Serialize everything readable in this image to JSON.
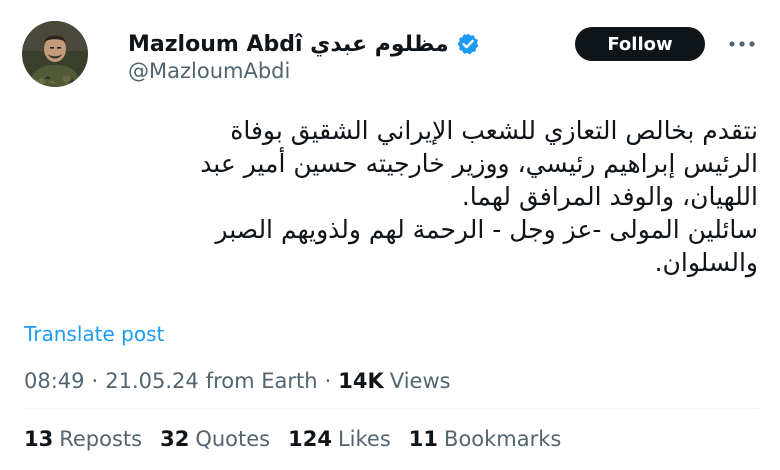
{
  "author": {
    "display_name": "Mazloum Abdî مظلوم عبدي",
    "handle": "@MazloumAbdi",
    "verified": true,
    "avatar_icon": "profile-photo-icon",
    "verified_icon": "verified-badge-icon"
  },
  "actions": {
    "follow_label": "Follow",
    "more_icon": "more-options-icon"
  },
  "post": {
    "text_lines": [
      "نتقدم بخالص التعازي للشعب الإيراني الشقيق بوفاة",
      "الرئيس إبراهيم رئيسي، ووزير خارجيته حسين أمير عبد",
      "اللهيان، والوفد المرافق لهما.",
      "سائلين المولى -عز وجل - الرحمة لهم ولذويهم الصبر",
      "والسلوان."
    ],
    "translate_label": "Translate post"
  },
  "meta": {
    "time": "08:49",
    "separator": "·",
    "date": "21.05.24",
    "source": "from Earth",
    "views_count": "14K",
    "views_label": "Views"
  },
  "stats": [
    {
      "count": "13",
      "label": "Reposts"
    },
    {
      "count": "32",
      "label": "Quotes"
    },
    {
      "count": "124",
      "label": "Likes"
    },
    {
      "count": "11",
      "label": "Bookmarks"
    }
  ],
  "colors": {
    "text_primary": "#0f1419",
    "text_secondary": "#536471",
    "link_blue": "#1d9bf0",
    "follow_bg": "#0f1419",
    "follow_text": "#ffffff",
    "divider": "#eff3f4"
  }
}
